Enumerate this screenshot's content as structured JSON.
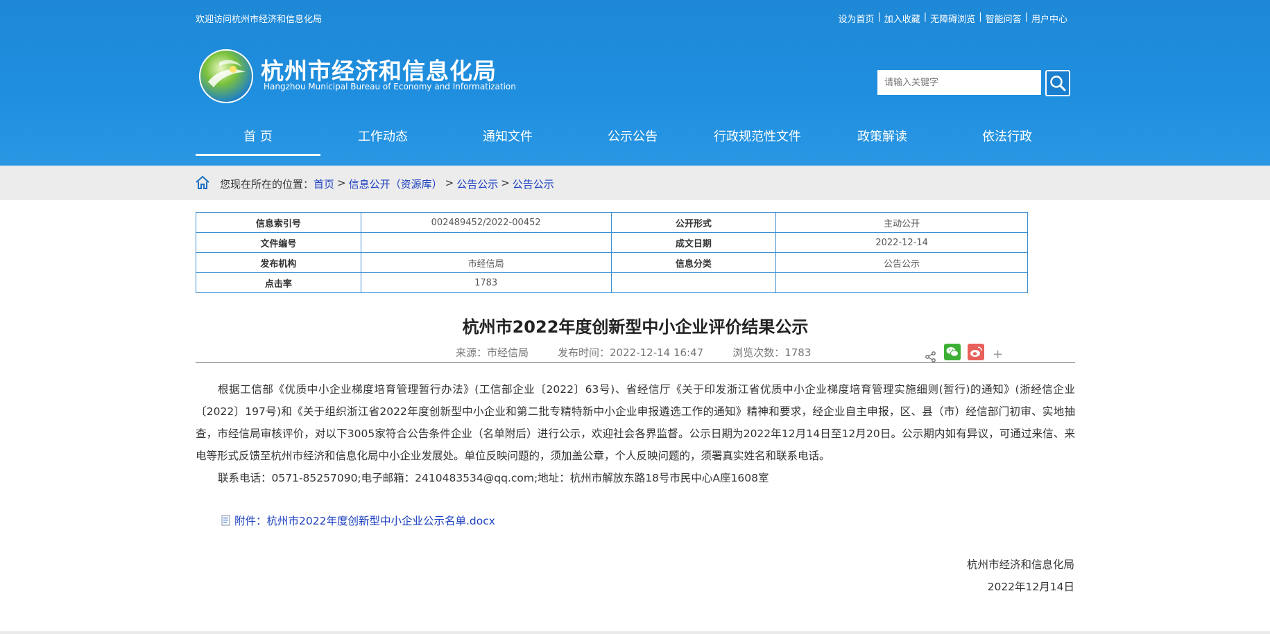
{
  "header": {
    "welcome": "欢迎访问杭州市经济和信息化局",
    "links": [
      "设为首页",
      "加入收藏",
      "无障碍浏览",
      "智能问答",
      "用户中心"
    ],
    "title": "杭州市经济和信息化局",
    "subtitle": "Hangzhou Municipal Bureau of Economy and Informatization",
    "search_placeholder": "请输入关键字",
    "search_icon": "search-icon",
    "colors": {
      "header_bg": "#1f8fdf",
      "link": "#1c3fbf",
      "table_border": "#3b8ed0"
    }
  },
  "nav": [
    "首 页",
    "工作动态",
    "通知文件",
    "公示公告",
    "行政规范性文件",
    "政策解读",
    "依法行政"
  ],
  "nav_active": "首 页",
  "breadcrumb": {
    "prefix": "您现在所在的位置：",
    "items": [
      "首页",
      "信息公开（资源库）",
      "公告公示",
      "公告公示"
    ]
  },
  "info": {
    "index_label": "信息索引号",
    "index_value": "002489452/2022-00452",
    "form_label": "公开形式",
    "form_value": "主动公开",
    "doc_no_label": "文件编号",
    "doc_no_value": "",
    "date_label": "成文日期",
    "date_value": "2022-12-14",
    "org_label": "发布机构",
    "org_value": "市经信局",
    "category_label": "信息分类",
    "category_value": "公告公示",
    "clicks_label": "点击率",
    "clicks_value": "1783"
  },
  "article": {
    "title": "杭州市2022年度创新型中小企业评价结果公示",
    "source": "来源：市经信局",
    "publish_time": "发布时间：2022-12-14 16:47",
    "views": "浏览次数：1783",
    "para1": "根据工信部《优质中小企业梯度培育管理暂行办法》(工信部企业〔2022〕63号)、省经信厅《关于印发浙江省优质中小企业梯度培育管理实施细则(暂行)的通知》(浙经信企业〔2022〕197号)和《关于组织浙江省2022年度创新型中小企业和第二批专精特新中小企业申报遴选工作的通知》精神和要求，经企业自主申报，区、县（市）经信部门初审、实地抽查，市经信局审核评价，对以下3005家符合公告条件企业（名单附后）进行公示，欢迎社会各界监督。公示日期为2022年12月14日至12月20日。公示期内如有异议，可通过来信、来电等形式反馈至杭州市经济和信息化局中小企业发展处。单位反映问题的，须加盖公章，个人反映问题的，须署真实姓名和联系电话。",
    "para2": "联系电话：0571-85257090;电子邮箱：2410483534@qq.com;地址：杭州市解放东路18号市民中心A座1608室",
    "attachment": "附件：杭州市2022年度创新型中小企业公示名单.docx",
    "sign_org": "杭州市经济和信息化局",
    "sign_date": "2022年12月14日",
    "share_plus": "+"
  }
}
